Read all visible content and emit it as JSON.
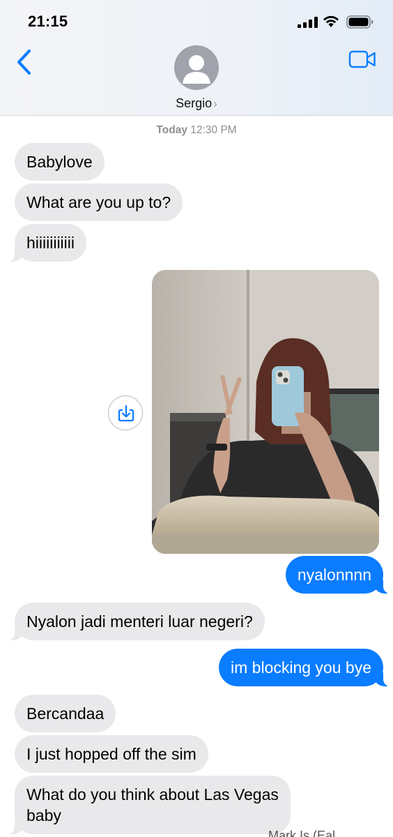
{
  "status_bar": {
    "time": "21:15"
  },
  "header": {
    "contact_name": "Sergio",
    "contact_chevron": "›",
    "back_icon": "chevron-left-icon",
    "video_icon": "video-camera-icon"
  },
  "conversation": {
    "timestamp_day": "Today",
    "timestamp_time": "12:30 PM",
    "messages": [
      {
        "from": "them",
        "text": "Babylove"
      },
      {
        "from": "them",
        "text": "What are you up to?"
      },
      {
        "from": "them",
        "text": "hiiiiiiiiiii"
      },
      {
        "from": "me",
        "type": "photo"
      },
      {
        "from": "me",
        "text": "nyalonnnn"
      },
      {
        "from": "them",
        "text": "Nyalon jadi menteri luar negeri?"
      },
      {
        "from": "me",
        "text": "im blocking you bye"
      },
      {
        "from": "them",
        "text": "Bercandaa"
      },
      {
        "from": "them",
        "text": "I just hopped off the sim"
      },
      {
        "from": "them",
        "text_line1": "What do you think about Las Vegas",
        "text_line2": "baby"
      }
    ],
    "photo_save_icon": "save-to-photos-icon",
    "truncated_footer": "Mark Is (Eal"
  },
  "colors": {
    "accent": "#0a7cff",
    "incoming_bubble": "#e9e9eb",
    "secondary_text": "#8e8e93"
  }
}
